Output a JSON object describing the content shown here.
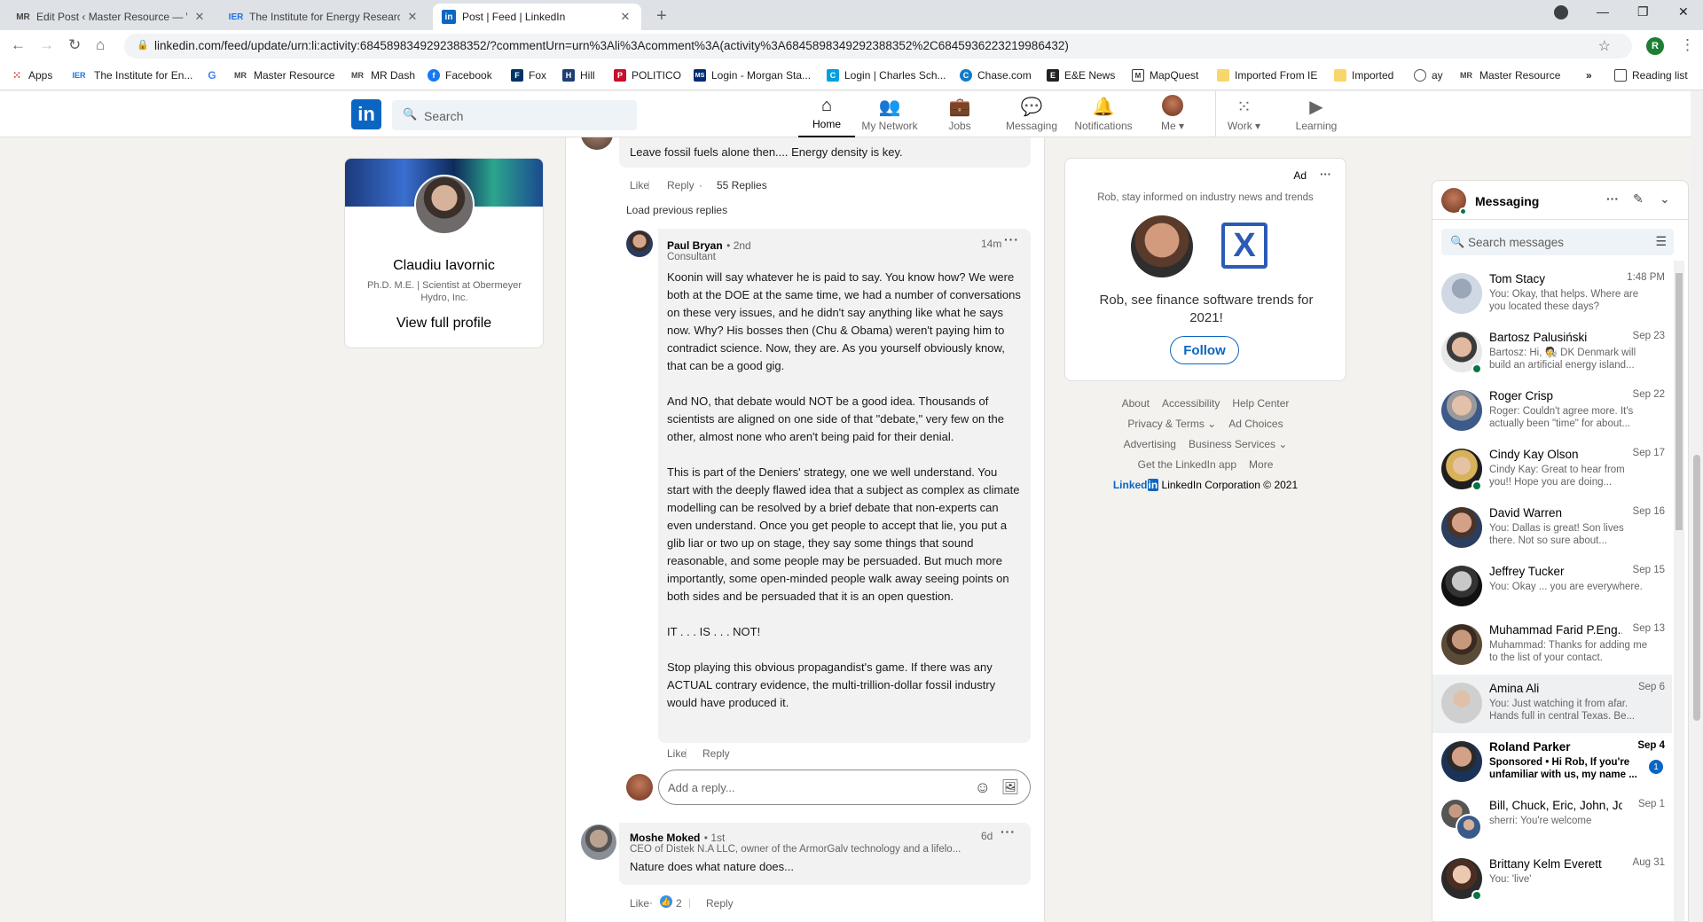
{
  "browser": {
    "tabs": [
      {
        "icon": "MR",
        "title": "Edit Post ‹ Master Resource — W"
      },
      {
        "icon": "IER",
        "title": "The Institute for Energy Research"
      },
      {
        "icon": "in",
        "title": "Post | Feed | LinkedIn"
      }
    ],
    "url": "linkedin.com/feed/update/urn:li:activity:6845898349292388352/?commentUrn=urn%3Ali%3Acomment%3A(activity%3A6845898349292388352%2C6845936223219986432)",
    "profile_initial": "R",
    "bookmarks": [
      {
        "icon": "grid-icon",
        "label": "Apps"
      },
      {
        "icon": "IER",
        "label": "The Institute for En..."
      },
      {
        "icon": "G",
        "label": ""
      },
      {
        "icon": "MR",
        "label": "Master Resource"
      },
      {
        "icon": "MR",
        "label": "MR Dash"
      },
      {
        "icon": "f",
        "label": "Facebook"
      },
      {
        "icon": "F",
        "label": "Fox"
      },
      {
        "icon": "H",
        "label": "Hill"
      },
      {
        "icon": "P",
        "label": "POLITICO"
      },
      {
        "icon": "MS",
        "label": "Login - Morgan Sta..."
      },
      {
        "icon": "C",
        "label": "Login | Charles Sch..."
      },
      {
        "icon": "C",
        "label": "Chase.com"
      },
      {
        "icon": "E",
        "label": "E&E News"
      },
      {
        "icon": "M",
        "label": "MapQuest"
      },
      {
        "icon": "folder-icon",
        "label": "Imported From IE"
      },
      {
        "icon": "folder-icon",
        "label": "Imported"
      },
      {
        "icon": "globe-icon",
        "label": "ay"
      },
      {
        "icon": "MR",
        "label": "Master Resource"
      }
    ],
    "more_bookmarks": "»",
    "reading_list": "Reading list"
  },
  "nav": {
    "logo": "in",
    "search_placeholder": "Search",
    "items": [
      {
        "label": "Home",
        "icon": "home-icon"
      },
      {
        "label": "My Network",
        "icon": "network-icon"
      },
      {
        "label": "Jobs",
        "icon": "briefcase-icon"
      },
      {
        "label": "Messaging",
        "icon": "chat-icon"
      },
      {
        "label": "Notifications",
        "icon": "bell-icon"
      },
      {
        "label": "Me",
        "icon": "avatar"
      },
      {
        "label": "Work",
        "icon": "grid-icon"
      },
      {
        "label": "Learning",
        "icon": "play-icon"
      }
    ]
  },
  "profile": {
    "name": "Claudiu Iavornic",
    "headline": "Ph.D. M.E. | Scientist at Obermeyer Hydro, Inc.",
    "view_full": "View full profile"
  },
  "feed": {
    "prev_comment": {
      "text": "Leave fossil fuels alone then.... Energy density is key.",
      "like": "Like",
      "reply": "Reply",
      "replies": "55 Replies"
    },
    "load_previous": "Load previous replies",
    "reply": {
      "author": "Paul Bryan",
      "degree": "• 2nd",
      "headline": "Consultant",
      "time": "14m",
      "paragraphs": [
        "Koonin will say whatever he is paid to say. You know how? We were both at the DOE at the same time, we had a number of conversations on these very issues, and he didn't say anything like what he says now. Why? His bosses then (Chu & Obama) weren't paying him to contradict science. Now, they are. As you yourself obviously know, that can be a good gig.",
        "And NO, that debate would NOT be a good idea. Thousands of scientists are aligned on one side of that \"debate,\" very few on the other, almost none who aren't being paid for their denial.",
        "This is part of the Deniers' strategy, one we well understand. You start with the deeply flawed idea that a subject as complex as climate modelling can be resolved by a brief debate that non-experts can even understand. Once you get people to accept that lie, you put a glib liar or two up on stage, they say some things that sound reasonable, and some people may be persuaded. But much more importantly, some open-minded people walk away seeing points on both sides and be persuaded that it is an open question.",
        "IT . . . IS . . . NOT!",
        "Stop playing this obvious propagandist's game. If there was any ACTUAL contrary evidence, the multi-trillion-dollar fossil industry would have produced it."
      ],
      "like": "Like",
      "reply": "Reply"
    },
    "reply_placeholder": "Add a reply...",
    "next_comment": {
      "author": "Moshe Moked",
      "degree": "• 1st",
      "headline": "CEO of Distek N.A LLC, owner of the ArmorGalv technology and a lifelo...",
      "time": "6d",
      "text": "Nature does what nature does...",
      "like": "Like",
      "reactions": "2",
      "reply": "Reply"
    }
  },
  "ad": {
    "label": "Ad",
    "subtitle": "Rob, stay informed on industry news and trends",
    "headline": "Rob, see finance software trends for 2021!",
    "follow": "Follow"
  },
  "footer": {
    "row1": [
      "About",
      "Accessibility",
      "Help Center"
    ],
    "row2": [
      "Privacy & Terms ⌄",
      "Ad Choices"
    ],
    "row3": [
      "Advertising",
      "Business Services ⌄"
    ],
    "row4": [
      "Get the LinkedIn app",
      "More"
    ],
    "brand": "Linked",
    "brand_in": "in",
    "copyright": "LinkedIn Corporation © 2021"
  },
  "messaging": {
    "title": "Messaging",
    "search_placeholder": "Search messages",
    "conversations": [
      {
        "name": "Tom Stacy",
        "date": "1:48 PM",
        "preview": "You: Okay, that helps. Where are you located these days?",
        "online": false
      },
      {
        "name": "Bartosz Palusiński",
        "date": "Sep 23",
        "preview": "Bartosz: Hi, 🧑‍🔬 DK Denmark will build an artificial energy island...",
        "online": true
      },
      {
        "name": "Roger Crisp",
        "date": "Sep 22",
        "preview": "Roger: Couldn't agree more. It's actually been \"time\" for about...",
        "online": false
      },
      {
        "name": "Cindy Kay Olson",
        "date": "Sep 17",
        "preview": "Cindy Kay: Great to hear from you!! Hope you are doing...",
        "online": true
      },
      {
        "name": "David Warren",
        "date": "Sep 16",
        "preview": "You: Dallas is great! Son lives there. Not so sure about...",
        "online": false
      },
      {
        "name": "Jeffrey Tucker",
        "date": "Sep 15",
        "preview": "You: Okay ... you are everywhere.",
        "online": false
      },
      {
        "name": "Muhammad Farid P.Eng...",
        "date": "Sep 13",
        "preview": "Muhammad: Thanks for adding me to the list of your contact.",
        "online": false
      },
      {
        "name": "Amina Ali",
        "date": "Sep 6",
        "preview": "You: Just watching it from afar. Hands full in central Texas. Be...",
        "online": false
      },
      {
        "name": "Roland Parker",
        "date": "Sep 4",
        "preview": "Sponsored • Hi Rob, If you're unfamiliar with us, my name ...",
        "online": false,
        "badge": "1"
      },
      {
        "name": "Bill, Chuck, Eric, John, Jo...",
        "date": "Sep 1",
        "preview": "sherri: You're welcome",
        "online": false
      },
      {
        "name": "Brittany Kelm Everett",
        "date": "Aug 31",
        "preview": "You: 'live'",
        "online": true
      }
    ]
  }
}
